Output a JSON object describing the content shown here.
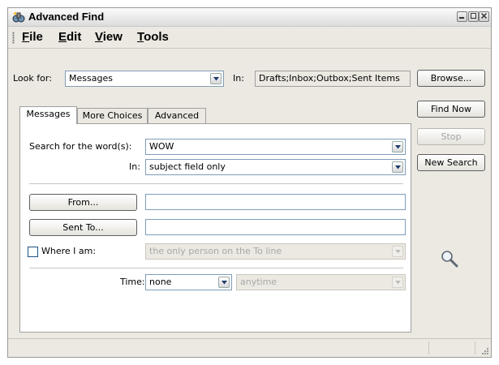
{
  "window": {
    "title": "Advanced Find",
    "icon": "find-binoculars-icon"
  },
  "menu": [
    {
      "label": "File"
    },
    {
      "label": "Edit"
    },
    {
      "label": "View"
    },
    {
      "label": "Tools"
    }
  ],
  "look_for": {
    "label": "Look for:",
    "value": "Messages"
  },
  "in_folders": {
    "label": "In:",
    "value": "Drafts;Inbox;Outbox;Sent Items"
  },
  "side_buttons": {
    "browse": "Browse...",
    "find_now": "Find Now",
    "stop": "Stop",
    "new_search": "New Search"
  },
  "tabs": [
    {
      "label": "Messages",
      "active": true
    },
    {
      "label": "More Choices",
      "active": false
    },
    {
      "label": "Advanced",
      "active": false
    }
  ],
  "messages_tab": {
    "search_words": {
      "label": "Search for the word(s):",
      "value": "WOW"
    },
    "in_field": {
      "label": "In:",
      "value": "subject field only"
    },
    "from": {
      "button": "From...",
      "value": ""
    },
    "sent_to": {
      "button": "Sent To...",
      "value": ""
    },
    "where_i_am": {
      "label": "Where I am:",
      "checked": false,
      "value": "the only person on the To line"
    },
    "time": {
      "label": "Time:",
      "value": "none",
      "range": "anytime"
    }
  },
  "colors": {
    "window_bg": "#ebe9e1",
    "field_border": "#7f9db9"
  }
}
